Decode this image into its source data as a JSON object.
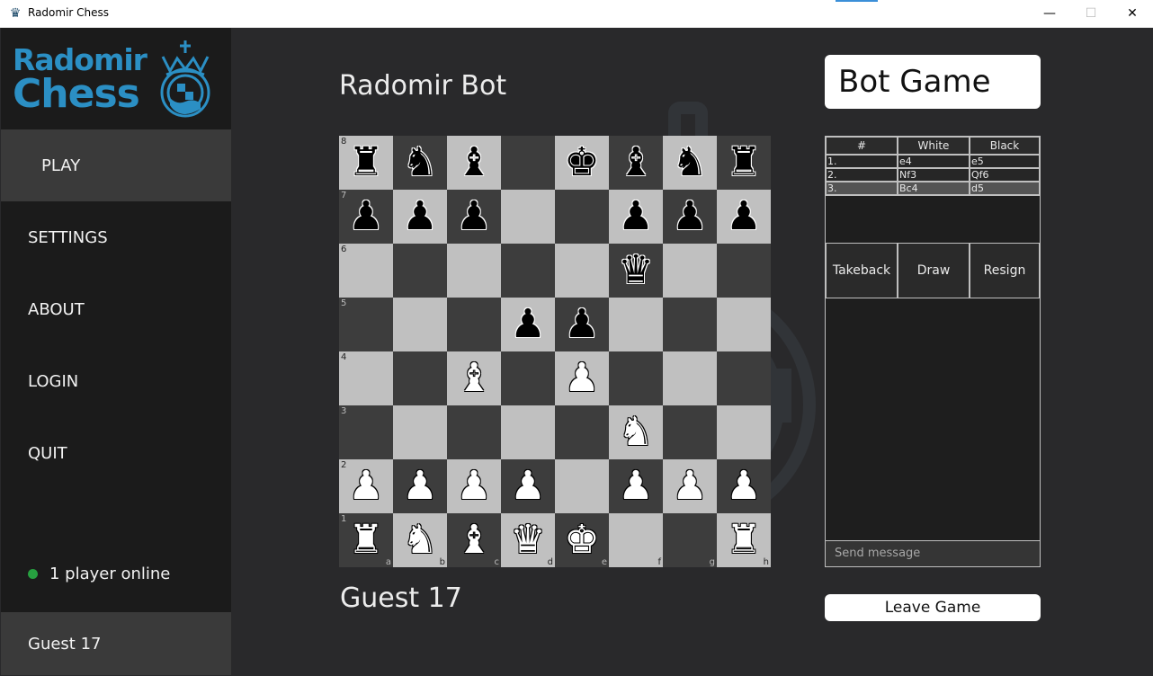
{
  "window": {
    "title": "Radomir Chess",
    "minimize_glyph": "—",
    "maximize_glyph": "☐",
    "close_glyph": "✕"
  },
  "logo": {
    "line1": "Radomir",
    "line2": "Chess",
    "crest_icon": "crown-crest-icon"
  },
  "nav": [
    {
      "label": "PLAY",
      "active": true
    },
    {
      "label": "SETTINGS",
      "active": false
    },
    {
      "label": "ABOUT",
      "active": false
    },
    {
      "label": "LOGIN",
      "active": false
    },
    {
      "label": "QUIT",
      "active": false
    }
  ],
  "status": {
    "online_text": "1 player online",
    "dot_color": "#27a040"
  },
  "user": {
    "name": "Guest 17"
  },
  "game": {
    "opponent": "Radomir Bot",
    "player": "Guest 17",
    "title": "Bot Game",
    "leave_label": "Leave Game"
  },
  "board": {
    "ranks": [
      "8",
      "7",
      "6",
      "5",
      "4",
      "3",
      "2",
      "1"
    ],
    "files": [
      "a",
      "b",
      "c",
      "d",
      "e",
      "f",
      "g",
      "h"
    ],
    "light_color": "#c0c0c0",
    "dark_color": "#3d3d3d",
    "position": [
      [
        "bR",
        "bN",
        "bB",
        "",
        "bK",
        "bB",
        "bN",
        "bR"
      ],
      [
        "bP",
        "bP",
        "bP",
        "",
        "",
        "bP",
        "bP",
        "bP"
      ],
      [
        "",
        "",
        "",
        "",
        "",
        "bQ",
        "",
        ""
      ],
      [
        "",
        "",
        "",
        "bP",
        "bP",
        "",
        "",
        ""
      ],
      [
        "",
        "",
        "wB",
        "",
        "wP",
        "",
        "",
        ""
      ],
      [
        "",
        "",
        "",
        "",
        "",
        "wN",
        "",
        ""
      ],
      [
        "wP",
        "wP",
        "wP",
        "wP",
        "",
        "wP",
        "wP",
        "wP"
      ],
      [
        "wR",
        "wN",
        "wB",
        "wQ",
        "wK",
        "",
        "",
        "wR"
      ]
    ]
  },
  "moves": {
    "headers": [
      "#",
      "White",
      "Black"
    ],
    "rows": [
      {
        "num": "1.",
        "white": "e4",
        "black": "e5"
      },
      {
        "num": "2.",
        "white": "Nf3",
        "black": "Qf6"
      },
      {
        "num": "3.",
        "white": "Bc4",
        "black": "d5"
      }
    ],
    "selected_row": 2
  },
  "actions": {
    "takeback": "Takeback",
    "draw": "Draw",
    "resign": "Resign"
  },
  "chat": {
    "placeholder": "Send message"
  }
}
